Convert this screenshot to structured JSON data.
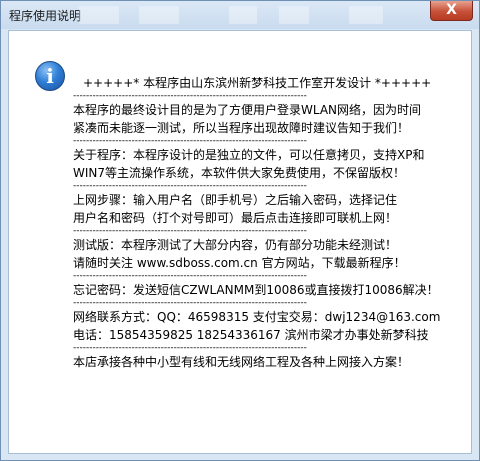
{
  "window": {
    "title": "程序使用说明",
    "close_symbol": "X"
  },
  "icon": {
    "name": "information-icon",
    "glyph": "i"
  },
  "content": {
    "header": "+++++* 本程序由山东滨州新梦科技工作室开发设计 *+++++",
    "separator": "------------------------------------------------------------------------",
    "sections": [
      [
        "本程序的最终设计目的是为了方便用户登录WLAN网络，因为时间",
        "紧凑而未能逐一测试，所以当程序出现故障时建议告知于我们！"
      ],
      [
        "关于程序：本程序设计的是独立的文件，可以任意拷贝，支持XP和",
        "WIN7等主流操作系统，本软件供大家免费使用，不保留版权！"
      ],
      [
        "上网步骤：输入用户名（即手机号）之后输入密码，选择记住",
        "用户名和密码（打个对号即可）最后点击连接即可联机上网！"
      ],
      [
        "测试版：本程序测试了大部分内容，仍有部分功能未经测试！",
        "请随时关注 www.sdboss.com.cn 官方网站，下载最新程序！"
      ],
      [
        "忘记密码：发送短信CZWLANMM到10086或直接拨打10086解决！"
      ],
      [
        "网络联系方式：QQ：46598315 支付宝交易：dwj1234@163.com",
        "电话：15854359825 18254336167 滨州市梁才办事处新梦科技"
      ],
      [
        "本店承接各种中小型有线和无线网络工程及各种上网接入方案！"
      ]
    ]
  }
}
